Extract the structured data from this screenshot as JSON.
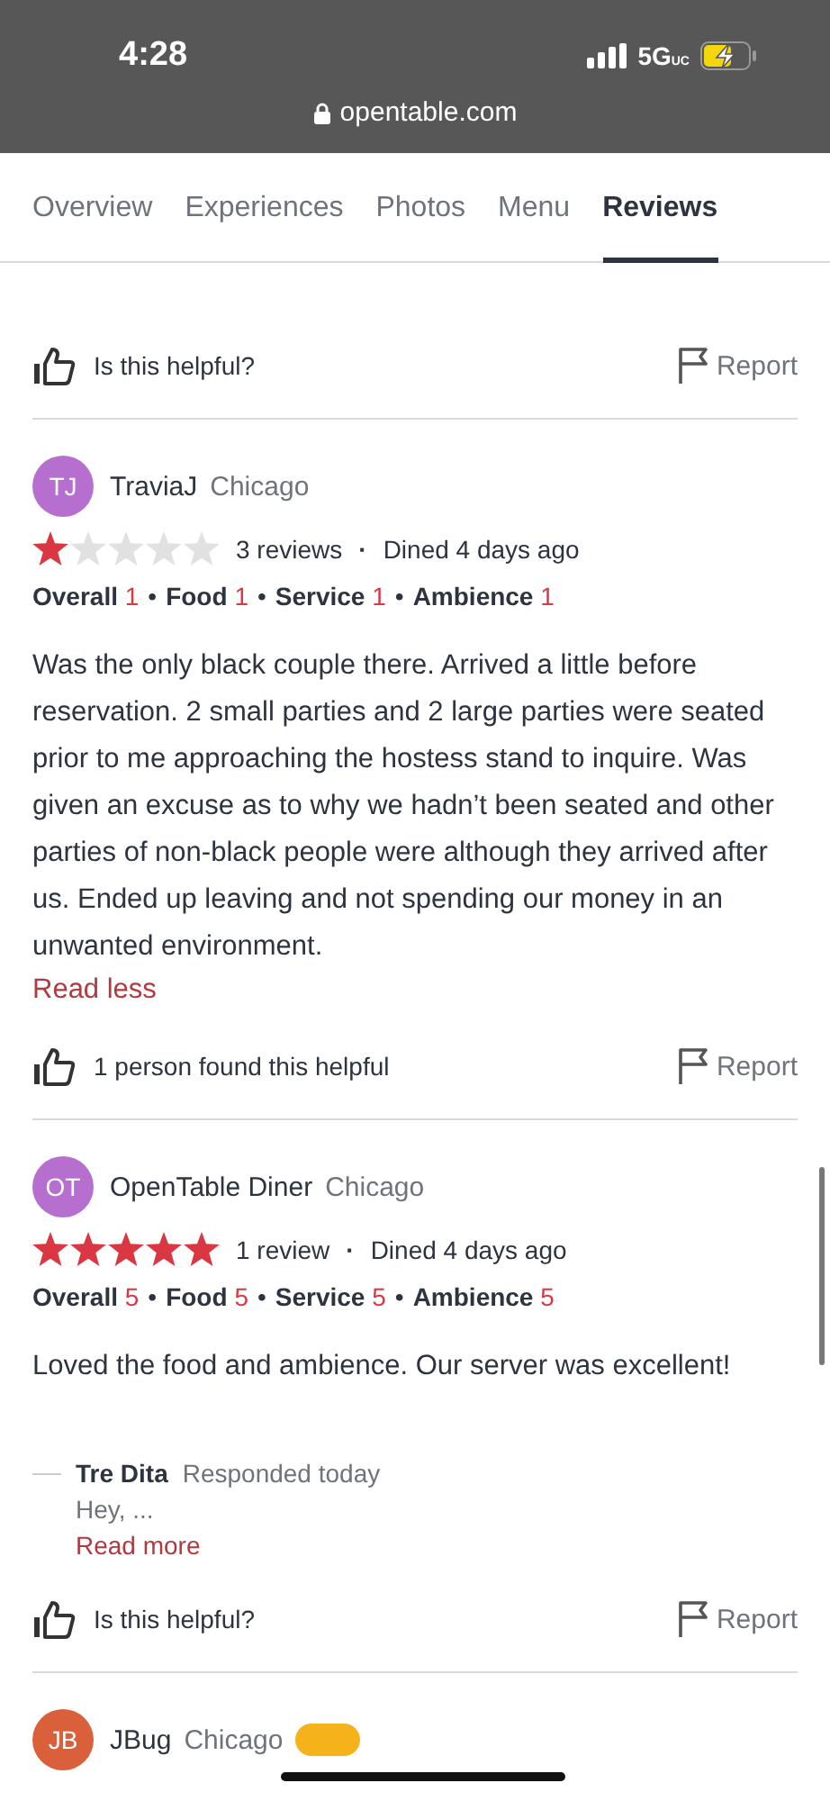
{
  "status_bar": {
    "time": "4:28",
    "network": "5G",
    "network_tag": "UC",
    "url": "opentable.com"
  },
  "tabs": [
    {
      "label": "Overview",
      "selected": false
    },
    {
      "label": "Experiences",
      "selected": false
    },
    {
      "label": "Photos",
      "selected": false
    },
    {
      "label": "Menu",
      "selected": false
    },
    {
      "label": "Reviews",
      "selected": true
    }
  ],
  "top_actions": {
    "helpful": "Is this helpful?",
    "report": "Report"
  },
  "reviews": [
    {
      "initials": "TJ",
      "color": "#b76fcf",
      "name": "TraviaJ",
      "location": "Chicago",
      "stars": 1,
      "meta": "3 reviews",
      "dined": "Dined 4 days ago",
      "dot": "·",
      "separator": "•",
      "ratings": [
        {
          "label": "Overall",
          "value": "1"
        },
        {
          "label": "Food",
          "value": "1"
        },
        {
          "label": "Service",
          "value": "1"
        },
        {
          "label": "Ambience",
          "value": "1"
        }
      ],
      "text": "Was the only black couple there. Arrived a little before reservation. 2 small parties and 2 large parties were seated prior to me approaching the hostess stand to inquire. Was given an excuse as to why we hadn’t been seated and other parties of non-black people were although they arrived after us. Ended up leaving and not spending our money in an unwanted environment.",
      "toggle": "Read less",
      "helpful": "1 person found this helpful",
      "report": "Report"
    },
    {
      "initials": "OT",
      "color": "#b76fcf",
      "name": "OpenTable Diner",
      "location": "Chicago",
      "stars": 5,
      "meta": "1 review",
      "dined": "Dined 4 days ago",
      "dot": "·",
      "separator": "•",
      "ratings": [
        {
          "label": "Overall",
          "value": "5"
        },
        {
          "label": "Food",
          "value": "5"
        },
        {
          "label": "Service",
          "value": "5"
        },
        {
          "label": "Ambience",
          "value": "5"
        }
      ],
      "text": "Loved the food and ambience.  Our server was excellent!",
      "response": {
        "name": "Tre Dita",
        "when": "Responded today",
        "text": "Hey, ...",
        "toggle": "Read more"
      },
      "helpful": "Is this helpful?",
      "report": "Report"
    },
    {
      "initials": "JB",
      "color": "#d9603b",
      "name": "JBug",
      "location": "Chicago",
      "vip": true
    }
  ]
}
